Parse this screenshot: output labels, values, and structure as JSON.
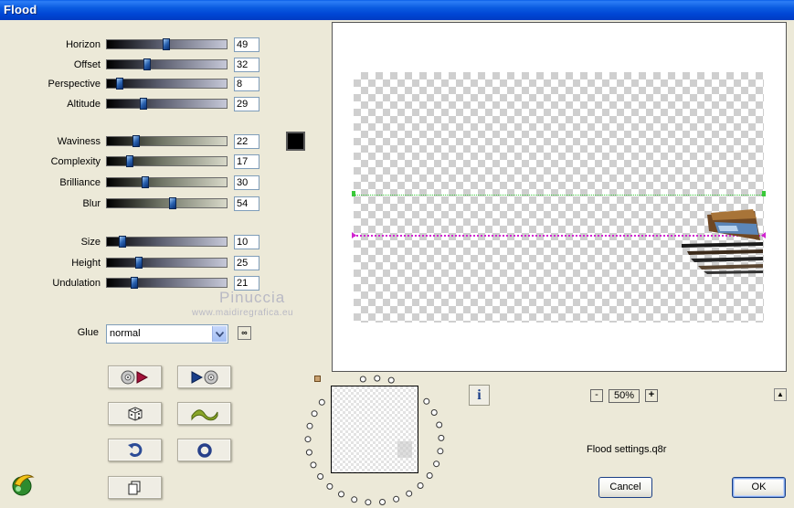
{
  "window": {
    "title": "Flood"
  },
  "sliders_group1": [
    {
      "label": "Horizon",
      "value": "49",
      "pos": 0.49
    },
    {
      "label": "Offset",
      "value": "32",
      "pos": 0.32
    },
    {
      "label": "Perspective",
      "value": "8",
      "pos": 0.08
    },
    {
      "label": "Altitude",
      "value": "29",
      "pos": 0.29
    }
  ],
  "sliders_group2": [
    {
      "label": "Waviness",
      "value": "22",
      "pos": 0.22
    },
    {
      "label": "Complexity",
      "value": "17",
      "pos": 0.17
    },
    {
      "label": "Brilliance",
      "value": "30",
      "pos": 0.3
    },
    {
      "label": "Blur",
      "value": "54",
      "pos": 0.54
    }
  ],
  "sliders_group3": [
    {
      "label": "Size",
      "value": "10",
      "pos": 0.1
    },
    {
      "label": "Height",
      "value": "25",
      "pos": 0.25
    },
    {
      "label": "Undulation",
      "value": "21",
      "pos": 0.21
    }
  ],
  "color_swatch": "#000000",
  "watermark": {
    "name": "Pinuccia",
    "url": "www.maidiregrafica.eu"
  },
  "glue": {
    "label": "Glue",
    "value": "normal",
    "link_icon": "link-icon"
  },
  "buttons": {
    "load_preset": "load-preset-icon",
    "save_preset": "save-preset-icon",
    "randomize": "dice-icon",
    "wave": "wave-icon",
    "undo": "undo-icon",
    "reset": "reset-icon",
    "copy": "copy-icon"
  },
  "preview": {
    "zoom": "50%",
    "info": "i",
    "minus": "-",
    "plus": "+",
    "up": "▲"
  },
  "settings_file": "Flood settings.q8r",
  "dialog": {
    "cancel": "Cancel",
    "ok": "OK"
  }
}
